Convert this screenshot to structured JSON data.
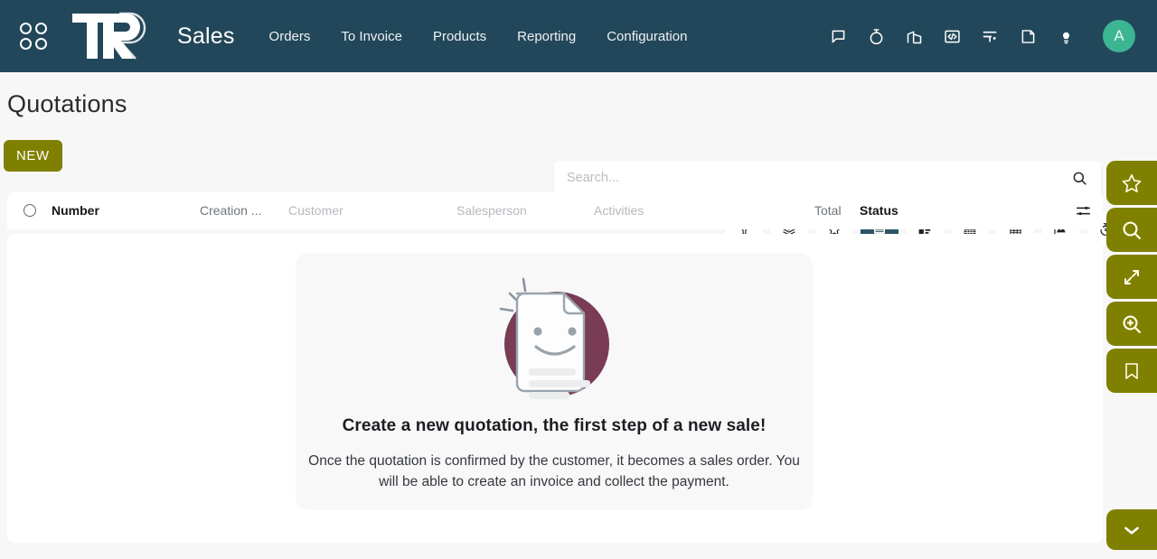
{
  "navbar": {
    "apps_icon": "apps-grid-icon",
    "logo_text": "TRP",
    "app_name": "Sales",
    "menu": [
      {
        "label": "Orders"
      },
      {
        "label": "To Invoice"
      },
      {
        "label": "Products"
      },
      {
        "label": "Reporting"
      },
      {
        "label": "Configuration"
      }
    ],
    "icons": [
      {
        "name": "messages-icon"
      },
      {
        "name": "timer-icon"
      },
      {
        "name": "company-icon"
      },
      {
        "name": "code-editor-icon"
      },
      {
        "name": "activity-board-icon"
      },
      {
        "name": "note-icon"
      },
      {
        "name": "bulb-icon"
      }
    ],
    "avatar_initial": "A",
    "avatar_color": "#3cb593",
    "background_color": "#23475a"
  },
  "control": {
    "page_title": "Quotations",
    "new_button": "NEW",
    "new_button_color": "#808000",
    "search": {
      "value": "",
      "placeholder": "Search..."
    },
    "views": [
      {
        "name": "filters-icon",
        "active": false
      },
      {
        "name": "group-by-layers-icon",
        "active": false
      },
      {
        "name": "favorites-star-icon",
        "active": false
      },
      {
        "name": "list-view-icon",
        "active": true
      },
      {
        "name": "kanban-view-icon",
        "active": false
      },
      {
        "name": "calendar-view-icon",
        "active": false
      },
      {
        "name": "pivot-view-icon",
        "active": false
      },
      {
        "name": "graph-view-icon",
        "active": false
      },
      {
        "name": "activity-view-icon",
        "active": false
      }
    ],
    "active_view_color": "#2c5566"
  },
  "table": {
    "columns": [
      {
        "label": "Number",
        "emphasis": "strong"
      },
      {
        "label": "Creation ...",
        "emphasis": "mid"
      },
      {
        "label": "Customer",
        "emphasis": "soft"
      },
      {
        "label": "Salesperson",
        "emphasis": "soft"
      },
      {
        "label": "Activities",
        "emphasis": "soft"
      },
      {
        "label": "Total",
        "emphasis": "mid"
      },
      {
        "label": "Status",
        "emphasis": "strong"
      }
    ],
    "rows": []
  },
  "empty_state": {
    "illustration": "smiling-document-icon",
    "title": "Create a new quotation, the first step of a new sale!",
    "subtitle": "Once the quotation is confirmed by the customer, it becomes a sales order. You will be able to create an invoice and collect the payment."
  },
  "rail": {
    "buttons": [
      {
        "name": "star-icon"
      },
      {
        "name": "search-icon"
      },
      {
        "name": "expand-icon"
      },
      {
        "name": "zoom-in-icon"
      },
      {
        "name": "bookmark-icon"
      }
    ],
    "collapse": {
      "name": "chevron-down-icon"
    },
    "color": "#808000"
  }
}
